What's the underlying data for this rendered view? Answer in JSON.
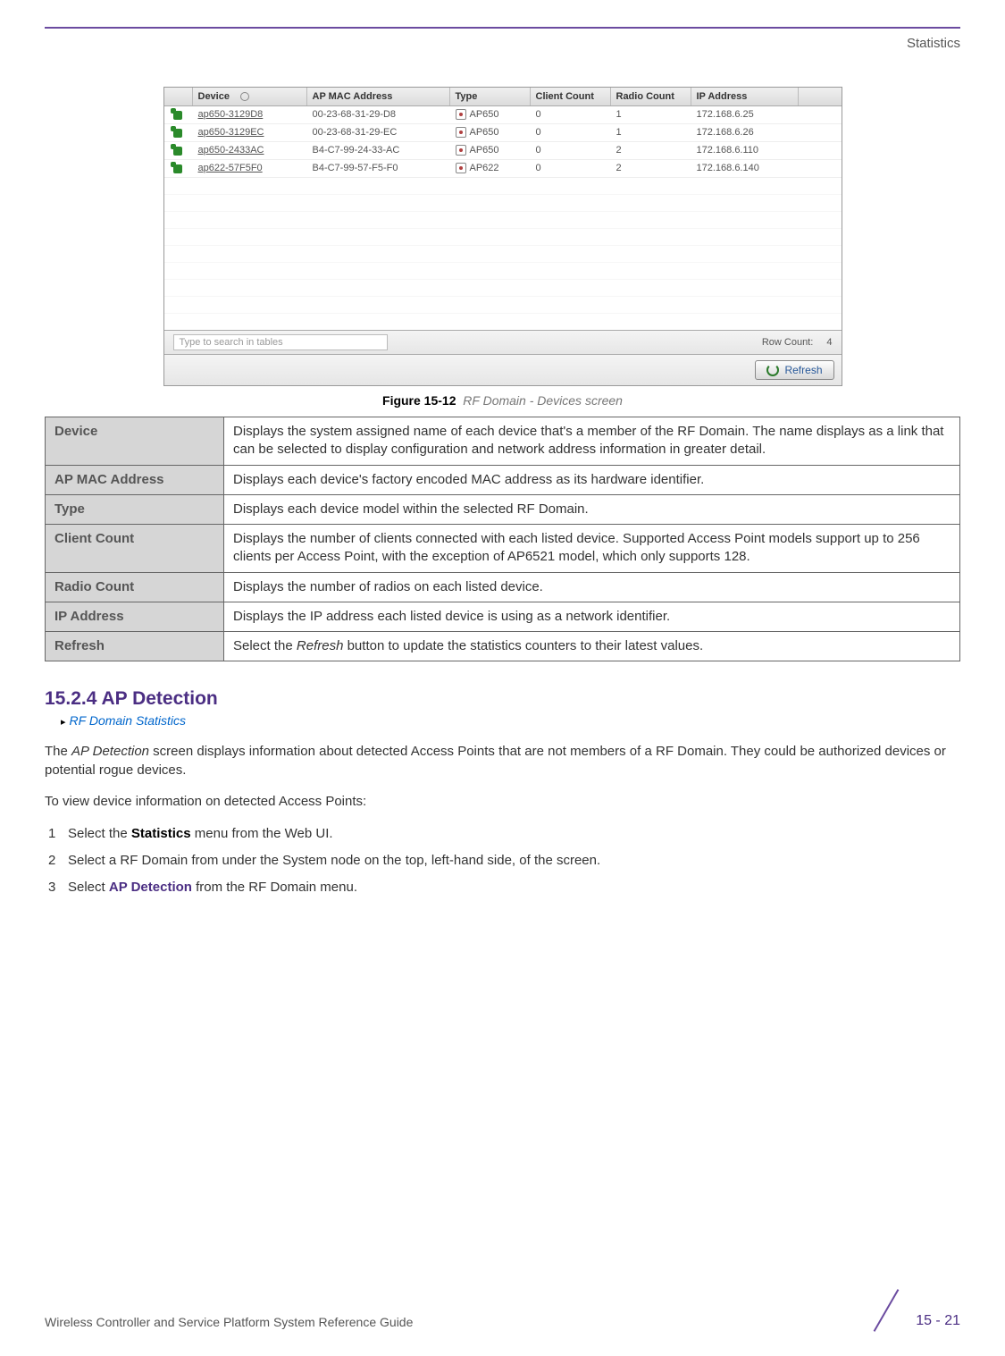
{
  "header": {
    "section": "Statistics"
  },
  "screenshot": {
    "columns": [
      "",
      "Device",
      "AP MAC Address",
      "Type",
      "Client Count",
      "Radio Count",
      "IP Address"
    ],
    "rows": [
      {
        "device": "ap650-3129D8",
        "mac": "00-23-68-31-29-D8",
        "type": "AP650",
        "cc": "0",
        "rc": "1",
        "ip": "172.168.6.25"
      },
      {
        "device": "ap650-3129EC",
        "mac": "00-23-68-31-29-EC",
        "type": "AP650",
        "cc": "0",
        "rc": "1",
        "ip": "172.168.6.26"
      },
      {
        "device": "ap650-2433AC",
        "mac": "B4-C7-99-24-33-AC",
        "type": "AP650",
        "cc": "0",
        "rc": "2",
        "ip": "172.168.6.110"
      },
      {
        "device": "ap622-57F5F0",
        "mac": "B4-C7-99-57-F5-F0",
        "type": "AP622",
        "cc": "0",
        "rc": "2",
        "ip": "172.168.6.140"
      }
    ],
    "search_placeholder": "Type to search in tables",
    "rowcount_label": "Row Count:",
    "rowcount_value": "4",
    "refresh_label": "Refresh"
  },
  "caption": {
    "bold": "Figure 15-12",
    "ital": "RF Domain - Devices screen"
  },
  "defs": [
    {
      "term": "Device",
      "desc": "Displays the system assigned name of each device that's a member of the RF Domain. The name displays as a link that can be selected to display configuration and network address information in greater detail."
    },
    {
      "term": "AP MAC Address",
      "desc": "Displays each device's factory encoded MAC address as its hardware identifier."
    },
    {
      "term": "Type",
      "desc": "Displays each device model within the selected RF Domain."
    },
    {
      "term": "Client Count",
      "desc": "Displays the number of clients connected with each listed device. Supported Access Point models support up to 256 clients per Access Point, with the exception of AP6521 model, which only supports 128."
    },
    {
      "term": "Radio Count",
      "desc": "Displays the number of radios on each listed device."
    },
    {
      "term": "IP Address",
      "desc": "Displays the IP address each listed device is using as a network identifier."
    },
    {
      "term": "Refresh",
      "desc_pre": "Select the ",
      "desc_em": "Refresh",
      "desc_post": " button to update the statistics counters to their latest values."
    }
  ],
  "section": {
    "heading": "15.2.4 AP Detection",
    "sublink": "RF Domain Statistics",
    "p1_pre": "The ",
    "p1_em": "AP Detection",
    "p1_post": " screen displays information about detected Access Points that are not members of a RF Domain. They could be authorized devices or potential rogue devices.",
    "p2": "To view device information on detected Access Points:",
    "steps": [
      {
        "pre": "Select the ",
        "b": "Statistics",
        "post": " menu from the Web UI."
      },
      {
        "pre": "Select a RF Domain from under the System node on the top, left-hand side, of the screen.",
        "b": "",
        "post": ""
      },
      {
        "pre": "Select ",
        "kw": "AP Detection",
        "post": " from the RF Domain menu."
      }
    ]
  },
  "footer": {
    "guide": "Wireless Controller and Service Platform System Reference Guide",
    "pageno": "15 - 21"
  }
}
